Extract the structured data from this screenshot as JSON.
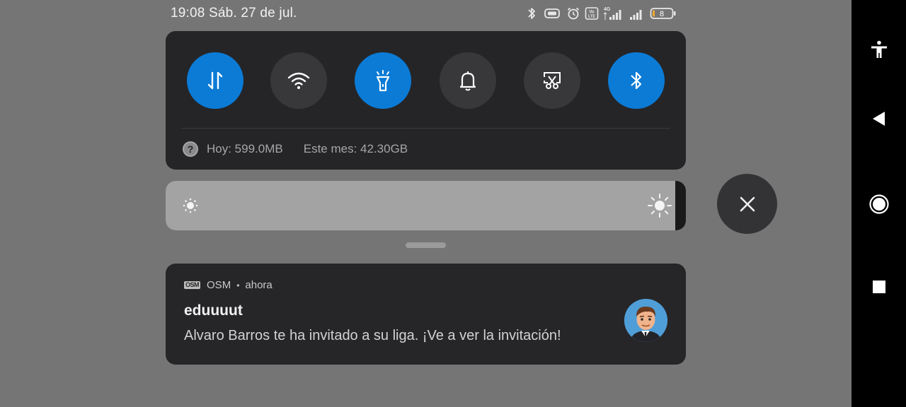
{
  "status_bar": {
    "time": "19:08",
    "date": "Sáb. 27 de jul.",
    "network_badge": "4G",
    "volte_badge": "Vo LTE",
    "battery_level": "8",
    "icons": [
      "bluetooth-icon",
      "vibrate-icon",
      "alarm-icon",
      "volte-icon",
      "signal-4g-icon",
      "signal-icon",
      "battery-icon"
    ]
  },
  "quick_settings": {
    "tiles": [
      {
        "name": "mobile-data",
        "icon": "data-arrows-icon",
        "active": true
      },
      {
        "name": "wifi",
        "icon": "wifi-icon",
        "active": false
      },
      {
        "name": "flashlight",
        "icon": "flashlight-icon",
        "active": true
      },
      {
        "name": "sound",
        "icon": "bell-icon",
        "active": false
      },
      {
        "name": "screenshot",
        "icon": "scissors-icon",
        "active": false
      },
      {
        "name": "bluetooth",
        "icon": "bluetooth-icon",
        "active": true
      }
    ],
    "usage_today": "Hoy: 599.0MB",
    "usage_month": "Este mes: 42.30GB",
    "accent_color": "#0b7bd6"
  },
  "brightness": {
    "level": 0.98
  },
  "notification": {
    "app_logo": "OSM",
    "app_name": "OSM",
    "separator": "•",
    "time": "ahora",
    "title": "eduuuut",
    "body": "Alvaro Barros te ha invitado a su liga. ¡Ve a ver la invitación!",
    "avatar": "manager-avatar"
  },
  "nav_bar": {
    "items": [
      "accessibility-icon",
      "back-icon",
      "home-icon",
      "recents-icon"
    ]
  }
}
